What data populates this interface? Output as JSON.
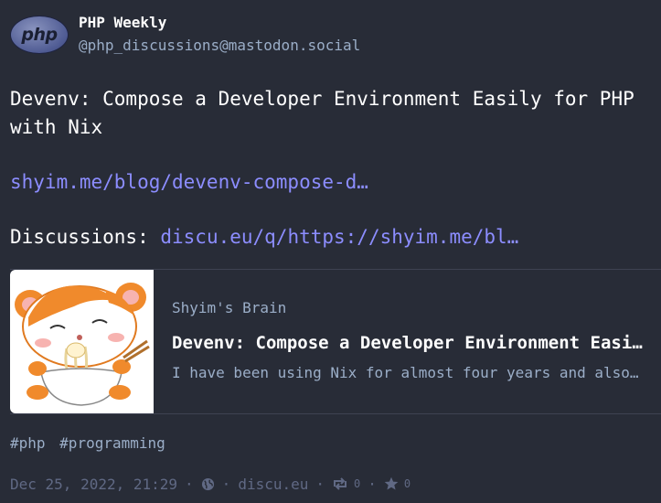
{
  "account": {
    "avatar_text": "php",
    "display_name": "PHP Weekly",
    "handle": "@php_discussions@mastodon.social"
  },
  "status": {
    "title_line": "Devenv: Compose a Developer Environment Easily for PHP with Nix",
    "link1": "shyim.me/blog/devenv-compose-d…",
    "discussions_label": "Discussions:",
    "link2": "discu.eu/q/https://shyim.me/bl…"
  },
  "card": {
    "provider": "Shyim's Brain",
    "title": "Devenv: Compose a Developer Environment Easily for PHP with Nix",
    "description": "I have been using Nix for almost four years and also maintain many packages"
  },
  "hashtags": [
    "#php",
    "#programming"
  ],
  "footer": {
    "timestamp": "Dec 25, 2022, 21:29",
    "visibility_icon": "globe-icon",
    "application": "discu.eu",
    "reblog_count": "0",
    "favourite_count": "0"
  },
  "colors": {
    "background": "#282c37",
    "link": "#8c8dff",
    "secondary": "#9baec8",
    "muted": "#606984"
  }
}
